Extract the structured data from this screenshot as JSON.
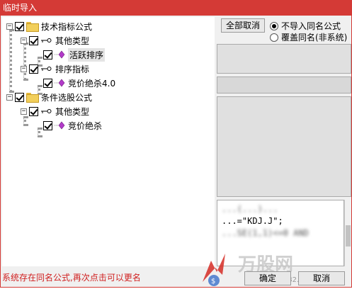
{
  "window": {
    "title": "临时导入"
  },
  "tree": {
    "nodes": [
      {
        "label": "技术指标公式",
        "type": "folder"
      },
      {
        "label": "其他类型",
        "type": "group"
      },
      {
        "label": "活跃排序",
        "type": "formula",
        "selected": true
      },
      {
        "label": "排序指标",
        "type": "group"
      },
      {
        "label": "竞价绝杀4.0",
        "type": "formula"
      },
      {
        "label": "条件选股公式",
        "type": "folder"
      },
      {
        "label": "其他类型",
        "type": "group"
      },
      {
        "label": "竞价绝杀",
        "type": "formula"
      }
    ]
  },
  "options": {
    "cancel_all_label": "全部取消",
    "radio_no_import": "不导入同名公式",
    "radio_overwrite": "覆盖同名(非系统)",
    "selected_radio": "no_import"
  },
  "code_preview": {
    "line1": "...=\"KDJ.J\";",
    "line2": "...SE(1,1)<=0 AND",
    "line3": "...(...)..."
  },
  "buttons": {
    "ok_label": "确定",
    "cancel_label": "取消"
  },
  "status": {
    "message": "系统存在同名公式,再次点击可以更名"
  },
  "watermark": {
    "brand": "万股网",
    "url": "www.201082.com"
  },
  "colors": {
    "titlebar": "#d43a36",
    "status_text": "#d02020",
    "checkbox_mark": "#000000"
  }
}
